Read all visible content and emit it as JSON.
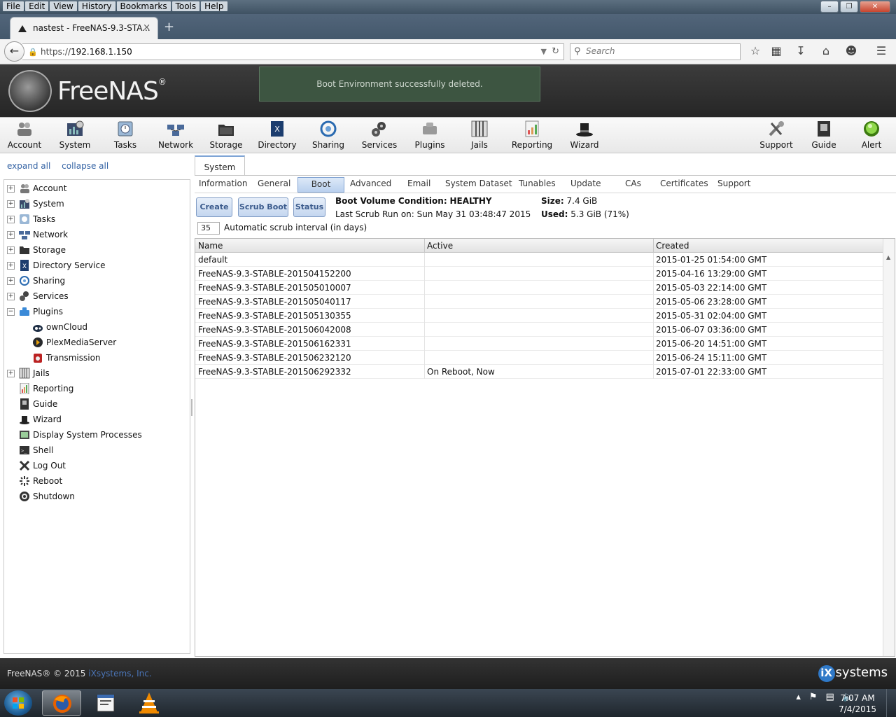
{
  "browser": {
    "menus": [
      "File",
      "Edit",
      "View",
      "History",
      "Bookmarks",
      "Tools",
      "Help"
    ],
    "tab_title": "nastest - FreeNAS-9.3-STA...",
    "tab_close": "×",
    "new_tab": "+",
    "url_prefix": "https://",
    "url_host": "192.168.1.150",
    "search_placeholder": "Search"
  },
  "header": {
    "logo_text": "FreeNAS",
    "logo_reg": "®",
    "notice": "Boot Environment successfully deleted."
  },
  "toolbar": {
    "items": [
      "Account",
      "System",
      "Tasks",
      "Network",
      "Storage",
      "Directory",
      "Sharing",
      "Services",
      "Plugins",
      "Jails",
      "Reporting",
      "Wizard",
      "Support",
      "Guide",
      "Alert"
    ]
  },
  "sidebar": {
    "expand_all": "expand all",
    "collapse_all": "collapse all",
    "items": [
      {
        "label": "Account"
      },
      {
        "label": "System"
      },
      {
        "label": "Tasks"
      },
      {
        "label": "Network"
      },
      {
        "label": "Storage"
      },
      {
        "label": "Directory Service"
      },
      {
        "label": "Sharing"
      },
      {
        "label": "Services"
      },
      {
        "label": "Plugins"
      },
      {
        "label": "ownCloud"
      },
      {
        "label": "PlexMediaServer"
      },
      {
        "label": "Transmission"
      },
      {
        "label": "Jails"
      },
      {
        "label": "Reporting"
      },
      {
        "label": "Guide"
      },
      {
        "label": "Wizard"
      },
      {
        "label": "Display System Processes"
      },
      {
        "label": "Shell"
      },
      {
        "label": "Log Out"
      },
      {
        "label": "Reboot"
      },
      {
        "label": "Shutdown"
      }
    ]
  },
  "main": {
    "tab": "System",
    "subtabs": [
      "Information",
      "General",
      "Boot",
      "Advanced",
      "Email",
      "System Dataset",
      "Tunables",
      "Update",
      "CAs",
      "Certificates",
      "Support"
    ],
    "active_subtab": "Boot",
    "buttons": {
      "create": "Create",
      "scrub": "Scrub Boot",
      "status": "Status"
    },
    "condition_label": "Boot Volume Condition:",
    "condition_value": "HEALTHY",
    "last_scrub": "Last Scrub Run on: Sun May 31 03:48:47 2015",
    "size_label": "Size:",
    "size_value": "7.4 GiB",
    "used_label": "Used:",
    "used_value": "5.3 GiB (71%)",
    "scrub_interval_value": "35",
    "scrub_interval_label": "Automatic scrub interval (in days)",
    "columns": [
      "Name",
      "Active",
      "Created"
    ],
    "rows": [
      {
        "name": "default",
        "active": "",
        "created": "2015-01-25 01:54:00 GMT"
      },
      {
        "name": "FreeNAS-9.3-STABLE-201504152200",
        "active": "",
        "created": "2015-04-16 13:29:00 GMT"
      },
      {
        "name": "FreeNAS-9.3-STABLE-201505010007",
        "active": "",
        "created": "2015-05-03 22:14:00 GMT"
      },
      {
        "name": "FreeNAS-9.3-STABLE-201505040117",
        "active": "",
        "created": "2015-05-06 23:28:00 GMT"
      },
      {
        "name": "FreeNAS-9.3-STABLE-201505130355",
        "active": "",
        "created": "2015-05-31 02:04:00 GMT"
      },
      {
        "name": "FreeNAS-9.3-STABLE-201506042008",
        "active": "",
        "created": "2015-06-07 03:36:00 GMT"
      },
      {
        "name": "FreeNAS-9.3-STABLE-201506162331",
        "active": "",
        "created": "2015-06-20 14:51:00 GMT"
      },
      {
        "name": "FreeNAS-9.3-STABLE-201506232120",
        "active": "",
        "created": "2015-06-24 15:11:00 GMT"
      },
      {
        "name": "FreeNAS-9.3-STABLE-201506292332",
        "active": "On Reboot, Now",
        "created": "2015-07-01 22:33:00 GMT"
      }
    ]
  },
  "footer": {
    "copyright": "FreeNAS® © 2015",
    "company": "iXsystems, Inc.",
    "brand_x": "iX",
    "brand_rest": "systems"
  },
  "taskbar": {
    "time": "7:07 AM",
    "date": "7/4/2015"
  },
  "colors": {
    "accent": "#3463a4",
    "notice_bg": "#3d5541",
    "active_tab": "#b9d0ee"
  }
}
